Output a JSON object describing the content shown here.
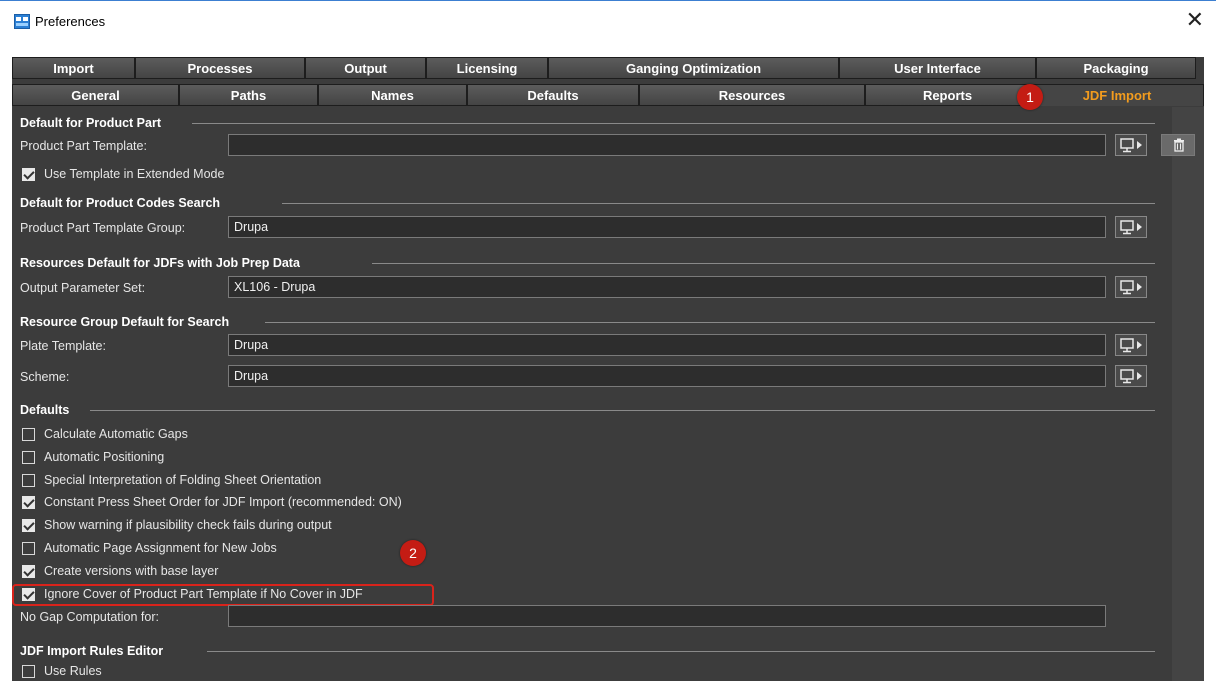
{
  "window": {
    "title": "Preferences",
    "close_glyph": "✕"
  },
  "tabs_row1": [
    "Import",
    "Processes",
    "Output",
    "Licensing",
    "Ganging Optimization",
    "User Interface",
    "Packaging"
  ],
  "tabs_row2": [
    "General",
    "Paths",
    "Names",
    "Defaults",
    "Resources",
    "Reports",
    "JDF Import"
  ],
  "active_tab": "JDF Import",
  "badges": {
    "b1": "1",
    "b2": "2"
  },
  "sections": {
    "product_part": {
      "title": "Default for Product Part",
      "template_label": "Product Part Template:",
      "template_value": "",
      "extended_mode_label": "Use Template in Extended Mode",
      "extended_mode_checked": true
    },
    "product_codes": {
      "title": "Default for Product Codes Search",
      "group_label": "Product Part Template Group:",
      "group_value": "Drupa"
    },
    "resources_jdf": {
      "title": "Resources Default for JDFs with Job Prep Data",
      "output_label": "Output Parameter Set:",
      "output_value": "XL106 - Drupa"
    },
    "resource_group": {
      "title": "Resource Group Default for Search",
      "plate_label": "Plate Template:",
      "plate_value": "Drupa",
      "scheme_label": "Scheme:",
      "scheme_value": "Drupa"
    },
    "defaults": {
      "title": "Defaults",
      "options": [
        {
          "label": "Calculate Automatic Gaps",
          "checked": false
        },
        {
          "label": "Automatic Positioning",
          "checked": false
        },
        {
          "label": "Special Interpretation of Folding Sheet Orientation",
          "checked": false
        },
        {
          "label": "Constant Press Sheet Order for JDF Import (recommended: ON)",
          "checked": true
        },
        {
          "label": "Show warning if plausibility check fails during output",
          "checked": true
        },
        {
          "label": "Automatic Page Assignment for New Jobs",
          "checked": false
        },
        {
          "label": "Create versions with base layer",
          "checked": true
        },
        {
          "label": "Ignore Cover of Product Part Template if No Cover in JDF",
          "checked": true
        }
      ],
      "no_gap_label": "No Gap Computation for:",
      "no_gap_value": ""
    },
    "rules_editor": {
      "title": "JDF Import Rules Editor",
      "use_rules_label": "Use Rules",
      "use_rules_checked": false
    }
  },
  "colors": {
    "accent_tab": "#f39c1e",
    "badge": "#c41c14",
    "highlight": "#d9231b",
    "panel": "#3c3c3c"
  },
  "icons": {
    "app": "preferences-app-icon",
    "picker": "template-picker-icon",
    "trash": "trash-icon"
  }
}
